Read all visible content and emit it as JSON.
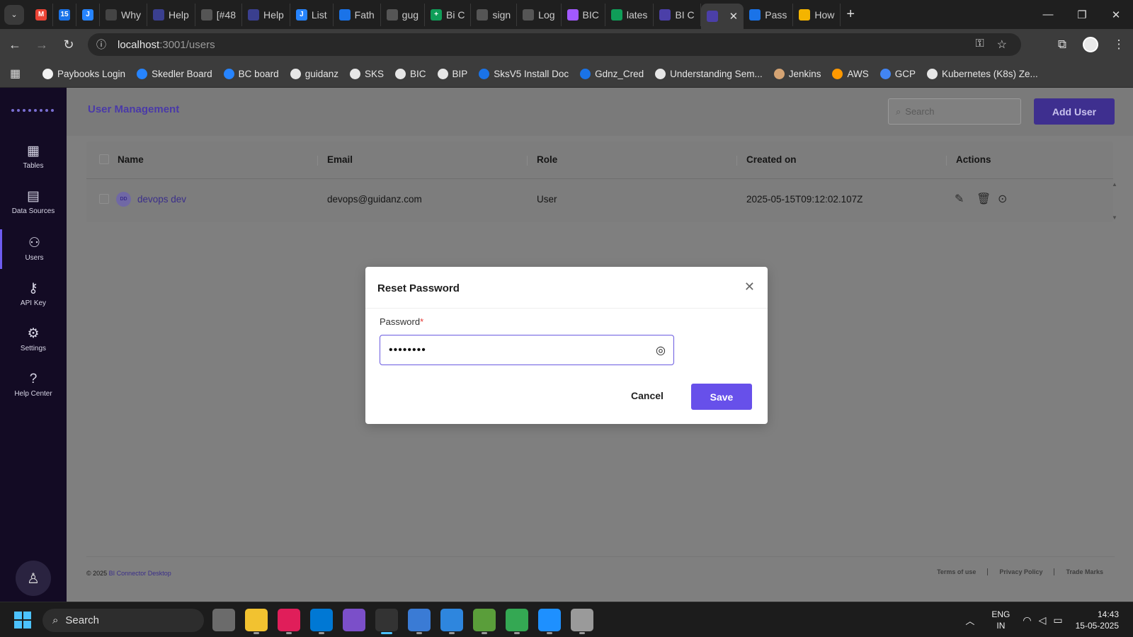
{
  "browser": {
    "tabs": [
      {
        "label": "",
        "color": "#ea4335",
        "glyph": "M"
      },
      {
        "label": "",
        "color": "#1a73e8",
        "glyph": "15"
      },
      {
        "label": "",
        "color": "#2684ff",
        "glyph": "J"
      },
      {
        "label": "Why",
        "color": "#444444",
        "glyph": ""
      },
      {
        "label": "Help",
        "color": "#3a3f8f",
        "glyph": ""
      },
      {
        "label": "[#48",
        "color": "#555555",
        "glyph": ""
      },
      {
        "label": "Help",
        "color": "#3a3f8f",
        "glyph": ""
      },
      {
        "label": "List",
        "color": "#2684ff",
        "glyph": "J"
      },
      {
        "label": "Fath",
        "color": "#1a73e8",
        "glyph": ""
      },
      {
        "label": "gug",
        "color": "#555555",
        "glyph": ""
      },
      {
        "label": "Bi C",
        "color": "#0f9d58",
        "glyph": "+"
      },
      {
        "label": "sign",
        "color": "#555555",
        "glyph": ""
      },
      {
        "label": "Log",
        "color": "#555555",
        "glyph": ""
      },
      {
        "label": "BIC",
        "color": "#a259ff",
        "glyph": ""
      },
      {
        "label": "lates",
        "color": "#0f9d58",
        "glyph": ""
      },
      {
        "label": "BI C",
        "color": "#4b3fa8",
        "glyph": ""
      },
      {
        "label": "",
        "color": "#4b3fa8",
        "glyph": ""
      },
      {
        "label": "Pass",
        "color": "#1a73e8",
        "glyph": ""
      },
      {
        "label": "How",
        "color": "#f4b400",
        "glyph": ""
      }
    ],
    "active_tab_index": 16,
    "url_host": "localhost",
    "url_path": ":3001/users",
    "bookmarks": [
      {
        "label": "Paybooks Login",
        "color": "#f1f1f1"
      },
      {
        "label": "Skedler Board",
        "color": "#2684ff"
      },
      {
        "label": "BC board",
        "color": "#2684ff"
      },
      {
        "label": "guidanz",
        "color": "#e6e6e6"
      },
      {
        "label": "SKS",
        "color": "#e6e6e6"
      },
      {
        "label": "BIC",
        "color": "#e6e6e6"
      },
      {
        "label": "BIP",
        "color": "#e6e6e6"
      },
      {
        "label": "SksV5 Install Doc",
        "color": "#1a73e8"
      },
      {
        "label": "Gdnz_Cred",
        "color": "#1a73e8"
      },
      {
        "label": "Understanding Sem...",
        "color": "#e6e6e6"
      },
      {
        "label": "Jenkins",
        "color": "#d4a373"
      },
      {
        "label": "AWS",
        "color": "#ff9900"
      },
      {
        "label": "GCP",
        "color": "#4285f4"
      },
      {
        "label": "Kubernetes (K8s) Ze...",
        "color": "#e6e6e6"
      }
    ]
  },
  "sidebar": {
    "items": [
      {
        "label": "Tables",
        "icon": "table-icon"
      },
      {
        "label": "Data Sources",
        "icon": "data-sources-icon"
      },
      {
        "label": "Users",
        "icon": "users-icon"
      },
      {
        "label": "API Key",
        "icon": "key-icon"
      },
      {
        "label": "Settings",
        "icon": "gear-icon"
      },
      {
        "label": "Help Center",
        "icon": "help-icon"
      }
    ],
    "active": "Users"
  },
  "header": {
    "title": "User Management",
    "search_placeholder": "Search",
    "add_user_label": "Add User"
  },
  "table": {
    "columns": [
      "Name",
      "Email",
      "Role",
      "Created on",
      "Actions"
    ],
    "rows": [
      {
        "initials": "DD",
        "name": "devops dev",
        "email": "devops@guidanz.com",
        "role": "User",
        "created_on": "2025-05-15T09:12:02.107Z"
      }
    ]
  },
  "footer": {
    "copyright_prefix": "© 2025",
    "app_name": "BI Connector Desktop",
    "links": [
      "Terms of use",
      "Privacy Policy",
      "Trade Marks"
    ]
  },
  "modal": {
    "title": "Reset Password",
    "field_label": "Password",
    "required_mark": "*",
    "password_masked": "••••••••",
    "cancel_label": "Cancel",
    "save_label": "Save"
  },
  "taskbar": {
    "search_label": "Search",
    "language": "ENG",
    "region": "IN",
    "time": "14:43",
    "date": "15-05-2025"
  },
  "colors": {
    "accent": "#6750ea",
    "sidebar_bg": "#130b24",
    "title_purple": "#4a3aa8"
  }
}
